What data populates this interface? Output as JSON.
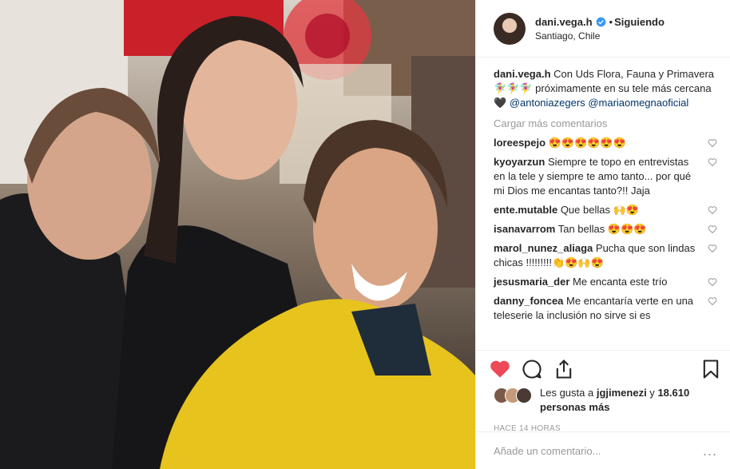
{
  "header": {
    "username": "dani.vega.h",
    "separator": "•",
    "follow_label": "Siguiendo",
    "location": "Santiago, Chile"
  },
  "caption": {
    "username": "dani.vega.h",
    "text": "Con Uds Flora, Fauna y Primavera 🧚‍♀️🧚‍♀️🧚‍♀️ próximamente en su tele más cercana 🖤 ",
    "mention_1": "@antoniazegers",
    "mention_2": "@mariaomegnaoficial"
  },
  "load_more_label": "Cargar más comentarios",
  "comments": [
    {
      "username": "loreespejo",
      "text": "😍😍😍😍😍😍"
    },
    {
      "username": "kyoyarzun",
      "text": "Siempre te topo en entrevistas en la tele y siempre te amo tanto... por qué mi Dios me encantas tanto?!! Jaja"
    },
    {
      "username": "ente.mutable",
      "text": "Que bellas 🙌😍"
    },
    {
      "username": "isanavarrom",
      "text": "Tan bellas 😍😍😍"
    },
    {
      "username": "marol_nunez_aliaga",
      "text": "Pucha que son lindas chicas !!!!!!!!!👏😍🙌😍"
    },
    {
      "username": "jesusmaria_der",
      "text": "Me encanta este trío"
    },
    {
      "username": "danny_foncea",
      "text": "Me encantaría verte en una teleserie la inclusión no sirve si es"
    }
  ],
  "likes": {
    "prefix": "Les gusta a ",
    "user": "jgjimenezi",
    "suffix": " y",
    "others": "18.610 personas más"
  },
  "timestamp": "HACE 14 HORAS",
  "add_comment_placeholder": "Añade un comentario...",
  "more_options": "...",
  "colors": {
    "like_red": "#ed4956",
    "verified_blue": "#3897f0",
    "link_blue": "#003569"
  },
  "icons": [
    "verified-icon",
    "heart-icon",
    "comment-icon",
    "share-icon",
    "bookmark-icon",
    "more-icon"
  ]
}
